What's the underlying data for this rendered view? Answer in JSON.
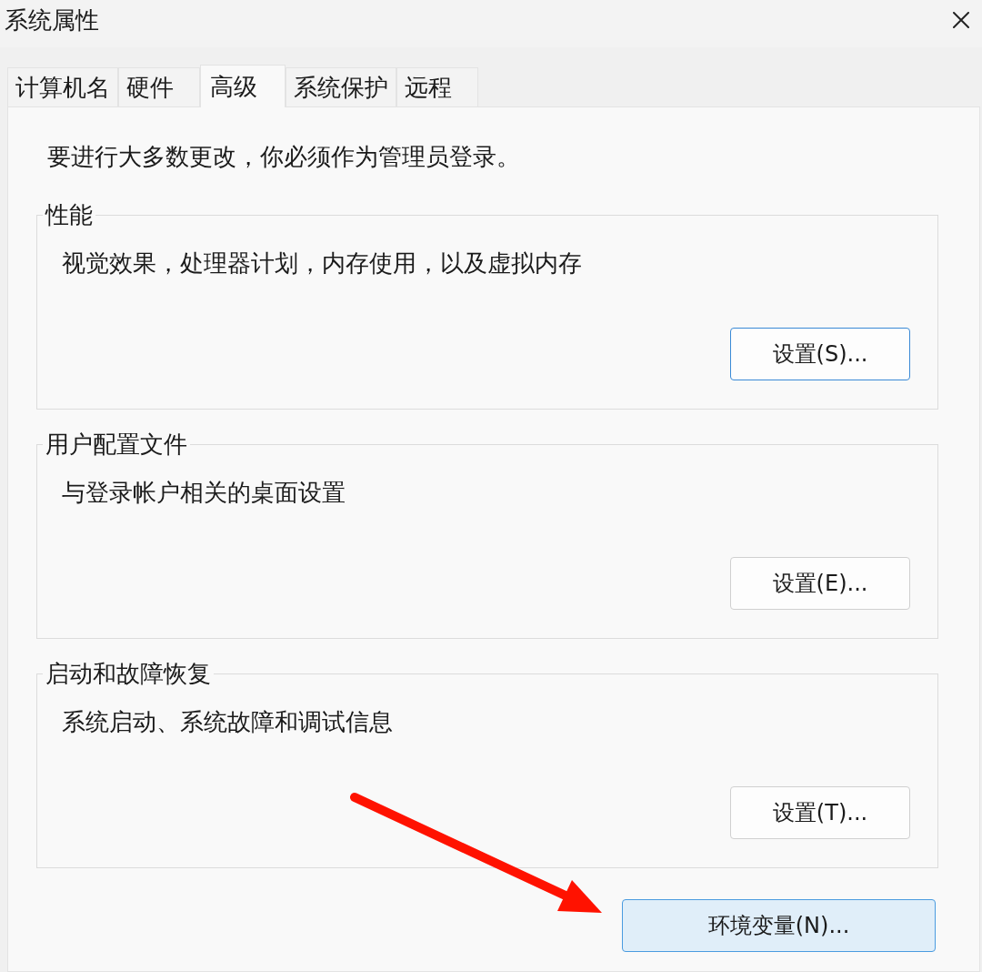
{
  "window": {
    "title": "系统属性"
  },
  "tabs": [
    {
      "label": "计算机名",
      "selected": false
    },
    {
      "label": "硬件",
      "selected": false
    },
    {
      "label": "高级",
      "selected": true
    },
    {
      "label": "系统保护",
      "selected": false
    },
    {
      "label": "远程",
      "selected": false
    }
  ],
  "notice": "要进行大多数更改，你必须作为管理员登录。",
  "groups": [
    {
      "title": "性能",
      "description": "视觉效果，处理器计划，内存使用，以及虚拟内存",
      "button": {
        "label": "设置(S)...",
        "focused": true,
        "hovered": false
      }
    },
    {
      "title": "用户配置文件",
      "description": "与登录帐户相关的桌面设置",
      "button": {
        "label": "设置(E)...",
        "focused": false,
        "hovered": false
      }
    },
    {
      "title": "启动和故障恢复",
      "description": "系统启动、系统故障和调试信息",
      "button": {
        "label": "设置(T)...",
        "focused": false,
        "hovered": false
      }
    }
  ],
  "footer_button": {
    "label": "环境变量(N)...",
    "focused": false,
    "hovered": true
  }
}
